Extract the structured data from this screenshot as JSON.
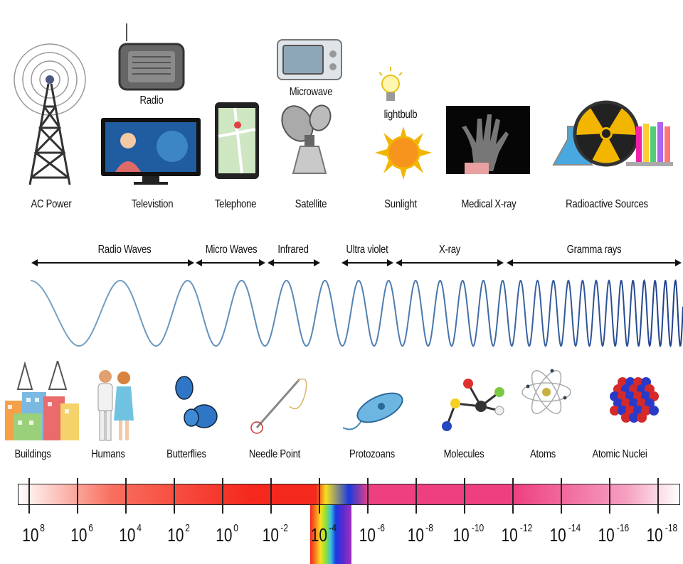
{
  "sources": [
    {
      "label": "AC Power",
      "icon": "radio-tower-icon"
    },
    {
      "label": "Televistion",
      "icon": "television-icon"
    },
    {
      "label": "Telephone",
      "icon": "smartphone-icon"
    },
    {
      "label": "Satellite",
      "icon": "satellite-dish-icon"
    },
    {
      "label": "Sunlight",
      "icon": "sun-icon"
    },
    {
      "label": "Medical X-ray",
      "icon": "xray-hand-icon"
    },
    {
      "label": "Radioactive Sources",
      "icon": "radiation-icon"
    }
  ],
  "upper_sources": [
    {
      "label": "Radio",
      "icon": "radio-icon"
    },
    {
      "label": "Microwave",
      "icon": "microwave-icon"
    },
    {
      "label": "lightbulb",
      "icon": "lightbulb-icon"
    }
  ],
  "bands": [
    {
      "label": "Radio Waves"
    },
    {
      "label": "Micro Waves"
    },
    {
      "label": "Infrared"
    },
    {
      "label": "Ultra violet"
    },
    {
      "label": "X-ray"
    },
    {
      "label": "Gramma rays"
    }
  ],
  "scales": [
    {
      "label": "Buildings",
      "icon": "buildings-icon"
    },
    {
      "label": "Humans",
      "icon": "humans-icon"
    },
    {
      "label": "Butterflies",
      "icon": "butterfly-icon"
    },
    {
      "label": "Needle Point",
      "icon": "needle-icon"
    },
    {
      "label": "Protozoans",
      "icon": "protozoan-icon"
    },
    {
      "label": "Molecules",
      "icon": "molecule-icon"
    },
    {
      "label": "Atoms",
      "icon": "atom-icon"
    },
    {
      "label": "Atomic Nuclei",
      "icon": "nucleus-icon"
    }
  ],
  "wavelength_axis": {
    "base": "10",
    "exponents": [
      "8",
      "6",
      "4",
      "2",
      "0",
      "-2",
      "-4",
      "-6",
      "-8",
      "-10",
      "-12",
      "-14",
      "-16",
      "-18"
    ]
  },
  "colors": {
    "wave": "#6a9cc0",
    "wave_end": "#1f3f8a",
    "bar_red": "#f5281e",
    "bar_pink": "#ee4080",
    "arrow": "#111111"
  }
}
